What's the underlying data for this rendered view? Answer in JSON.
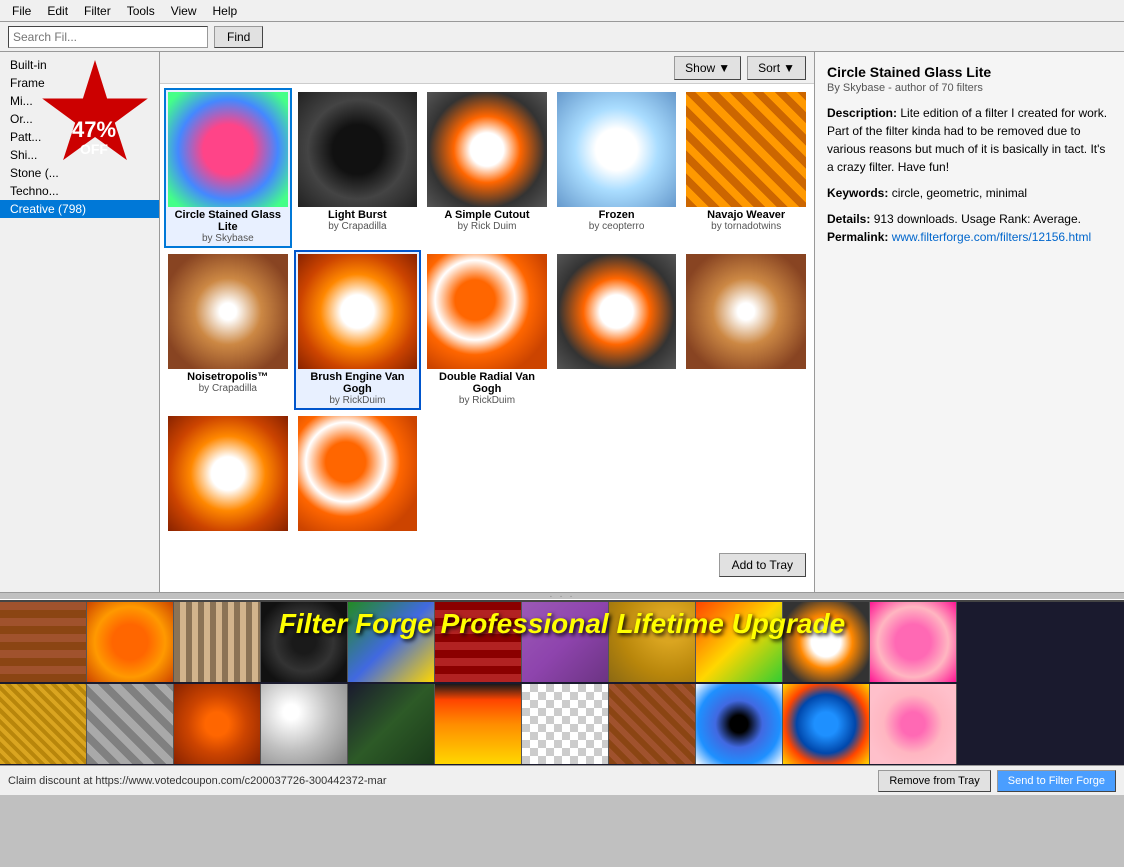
{
  "app": {
    "title": "Filter Forge Professional Lifetime Upgrade"
  },
  "menubar": {
    "items": [
      "File",
      "Edit",
      "Filter",
      "Tools",
      "View",
      "Help"
    ]
  },
  "searchbar": {
    "placeholder": "Search Fil...",
    "find_label": "Find"
  },
  "sidebar": {
    "items": [
      {
        "label": "Built-in",
        "active": false
      },
      {
        "label": "Frame",
        "active": false
      },
      {
        "label": "Mi...",
        "active": false
      },
      {
        "label": "Or...",
        "active": false
      },
      {
        "label": "Patt...",
        "active": false
      },
      {
        "label": "Shi...",
        "active": false
      },
      {
        "label": "Stone (...",
        "active": false
      },
      {
        "label": "Techno...",
        "active": false
      },
      {
        "label": "Creative (798)",
        "active": true
      }
    ]
  },
  "content": {
    "show_label": "Show",
    "sort_label": "Sort",
    "filters": [
      {
        "name": "Circle Stained Glass Lite",
        "author": "by Skybase",
        "thumb": "stained",
        "selected": true
      },
      {
        "name": "Light Burst",
        "author": "by Crapadilla",
        "thumb": "dark-spiral"
      },
      {
        "name": "A Simple Cutout",
        "author": "by Rick Duim",
        "thumb": "orange-ring"
      },
      {
        "name": "Frozen",
        "author": "by ceopterro",
        "thumb": "frozen"
      },
      {
        "name": "Navajo Weaver",
        "author": "by tornadotwins",
        "thumb": "weaver"
      },
      {
        "name": "Noisetropolis™",
        "author": "by Crapadilla",
        "thumb": "noise"
      },
      {
        "name": "Brush Engine Van Gogh",
        "author": "by RickDuim",
        "thumb": "brush",
        "checked": true
      },
      {
        "name": "Double Radial Van Gogh",
        "author": "by RickDuim",
        "thumb": "double-radial"
      },
      {
        "name": "",
        "author": "",
        "thumb": "orange-ring"
      },
      {
        "name": "",
        "author": "",
        "thumb": "noise"
      },
      {
        "name": "",
        "author": "",
        "thumb": "brush"
      },
      {
        "name": "",
        "author": "",
        "thumb": "double-radial"
      }
    ]
  },
  "right_panel": {
    "title": "Circle Stained Glass Lite",
    "author": "By Skybase - author of 70 filters",
    "description_label": "Description:",
    "description": "Lite edition of a filter I created for work. Part of the filter kinda had to be removed due to various reasons but much of it is basically in tact. It's a crazy filter. Have fun!",
    "keywords_label": "Keywords:",
    "keywords": "circle, geometric, minimal",
    "details_label": "Details:",
    "details": "913 downloads. Usage Rank: Average.",
    "permalink_label": "Permalink:",
    "permalink": "www.filterforge.com/filters/12156.html",
    "add_to_tray_label": "Add to Tray"
  },
  "bottom_bar": {
    "coupon_text": "Claim discount at https://www.votedcoupon.com/c200037726-300442372-mar",
    "remove_label": "Remove from Tray",
    "send_label": "Send to Filter Forge"
  },
  "promo": {
    "text": "Filter Forge Professional Lifetime Upgrade"
  },
  "badge": {
    "percent": "47%",
    "off": "OFF"
  }
}
